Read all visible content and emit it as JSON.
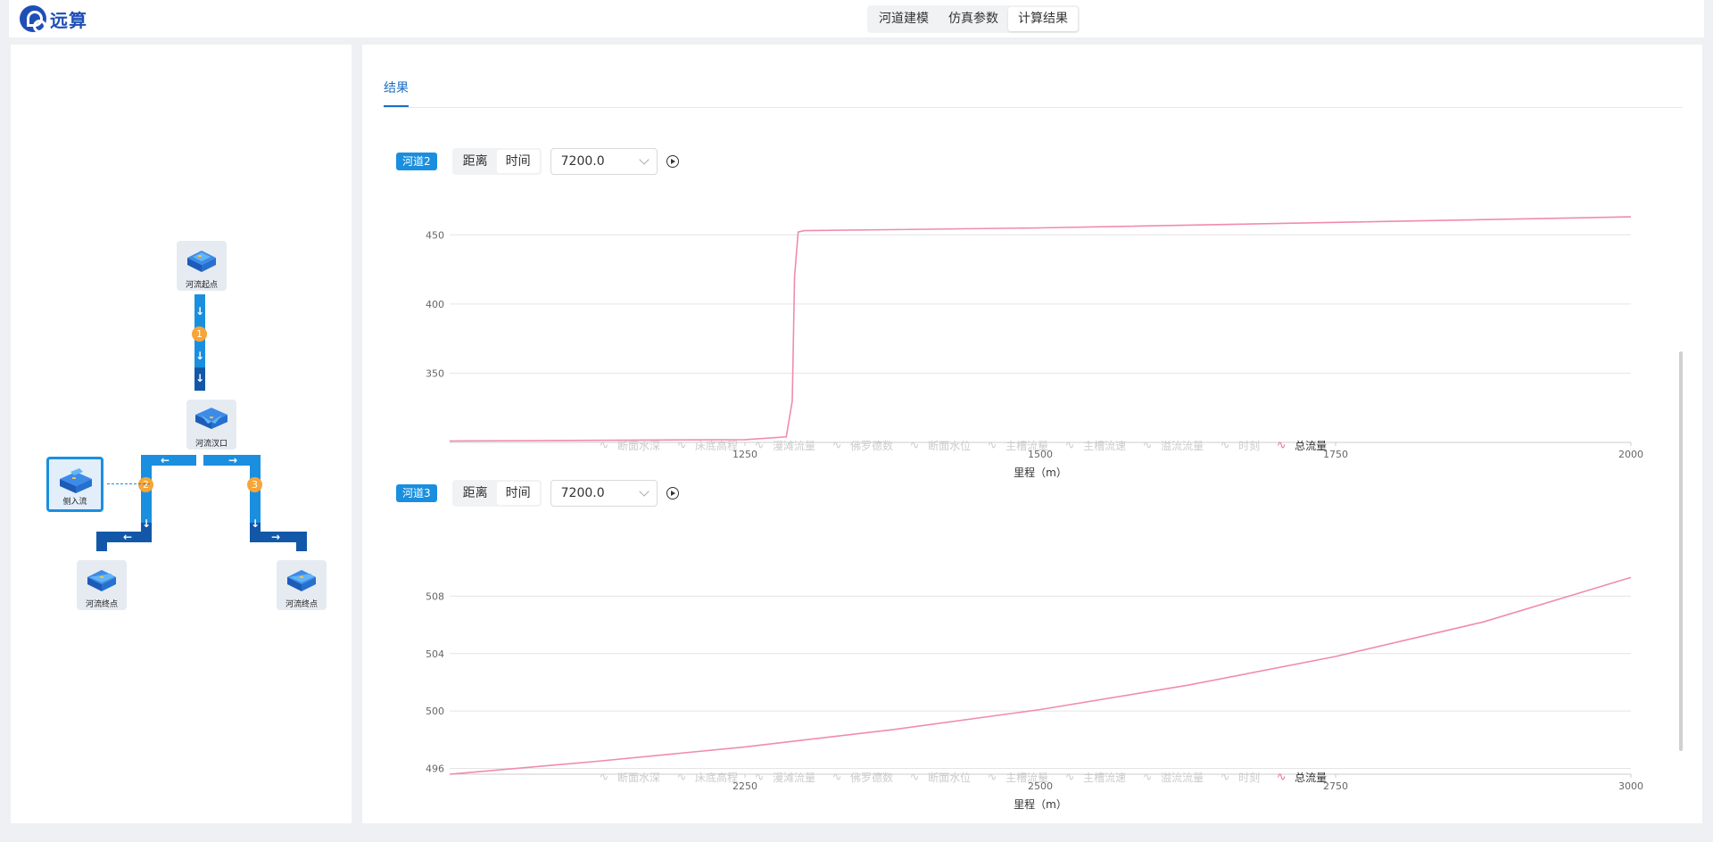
{
  "app": {
    "logo_text": "远算"
  },
  "topnav": {
    "items": [
      "河道建模",
      "仿真参数",
      "计算结果"
    ],
    "active": 2
  },
  "tree": {
    "nodes": {
      "source": "河流起点",
      "junction": "河流汊口",
      "inflow": "侧入流",
      "end_left": "河流终点",
      "end_right": "河流终点"
    },
    "badges": [
      "1",
      "2",
      "3"
    ]
  },
  "result_tab": "结果",
  "legend_items": [
    "断面水深",
    "床底高程",
    "漫滩流量",
    "佛罗德数",
    "断面水位",
    "主槽流量",
    "主槽流速",
    "溢流流量",
    "时刻",
    "总流量"
  ],
  "charts": [
    {
      "tag": "河道2",
      "segments": [
        "距离",
        "时间"
      ],
      "active_segment": 1,
      "select_value": "7200.0",
      "xlabel": "里程（m）"
    },
    {
      "tag": "河道3",
      "segments": [
        "距离",
        "时间"
      ],
      "active_segment": 1,
      "select_value": "7200.0",
      "xlabel": "里程（m）"
    }
  ],
  "chart_data": [
    {
      "type": "line",
      "title": "",
      "xlabel": "里程（m）",
      "ylabel": "",
      "x_ticks": [
        1250,
        1500,
        1750,
        2000
      ],
      "y_ticks": [
        350,
        400,
        450
      ],
      "xlim": [
        1000,
        2000
      ],
      "ylim": [
        300,
        465
      ],
      "legend_position": "bottom",
      "grid": true,
      "series": [
        {
          "name": "总流量",
          "color": "#f08cab",
          "x": [
            1000,
            1250,
            1285,
            1290,
            1292,
            1295,
            1300,
            1500,
            1750,
            2000
          ],
          "y": [
            301,
            302,
            304,
            330,
            420,
            452,
            453,
            455,
            459,
            463
          ]
        }
      ]
    },
    {
      "type": "line",
      "title": "",
      "xlabel": "里程（m）",
      "ylabel": "",
      "x_ticks": [
        2250,
        2500,
        2750,
        3000
      ],
      "y_ticks": [
        496,
        500,
        504,
        508
      ],
      "xlim": [
        2000,
        3000
      ],
      "ylim": [
        495.6,
        511.5
      ],
      "legend_position": "bottom",
      "grid": true,
      "series": [
        {
          "name": "总流量",
          "color": "#f08cab",
          "x": [
            2000,
            2125,
            2250,
            2375,
            2500,
            2625,
            2750,
            2875,
            3000
          ],
          "y": [
            495.6,
            496.5,
            497.5,
            498.7,
            500.1,
            501.8,
            503.8,
            506.2,
            509.3
          ]
        }
      ]
    }
  ]
}
